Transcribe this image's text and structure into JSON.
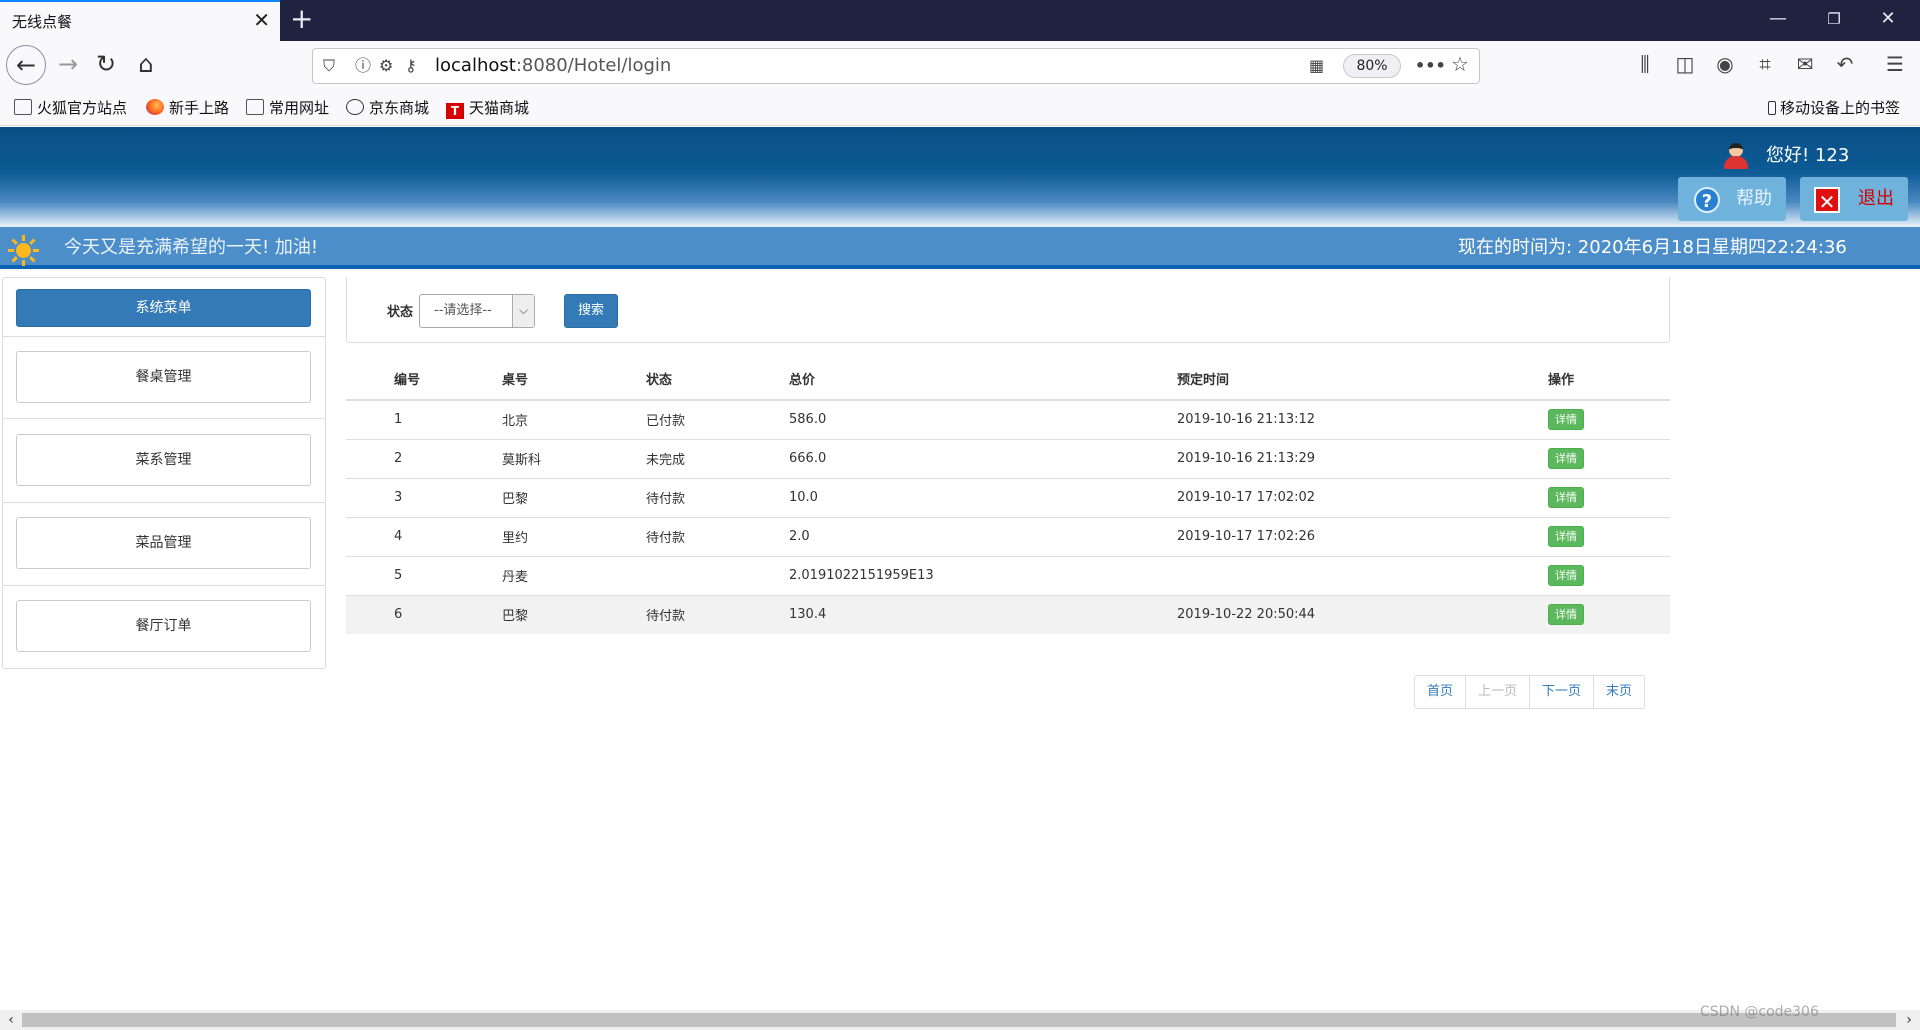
{
  "browser": {
    "tab_title": "无线点餐",
    "url_host": "localhost",
    "url_rest": ":8080/Hotel/login",
    "zoom": "80%",
    "bookmarks": [
      "火狐官方站点",
      "新手上路",
      "常用网址",
      "京东商城",
      "天猫商城"
    ],
    "mobile_bookmarks": "移动设备上的书签"
  },
  "header": {
    "greeting": "您好! 123",
    "help_label": "帮助",
    "exit_label": "退出",
    "motto": "今天又是充满希望的一天! 加油!",
    "clock": "现在的时间为: 2020年6月18日星期四22:24:36"
  },
  "sidebar": {
    "title": "系统菜单",
    "items": [
      "餐桌管理",
      "菜系管理",
      "菜品管理",
      "餐厅订单"
    ]
  },
  "search": {
    "status_label": "状态",
    "select_value": "--请选择--",
    "button_label": "搜索"
  },
  "table": {
    "headers": [
      "编号",
      "桌号",
      "状态",
      "总价",
      "预定时间",
      "操作"
    ],
    "rows": [
      {
        "id": "1",
        "table": "北京",
        "status": "已付款",
        "total": "586.0",
        "time": "2019-10-16 21:13:12",
        "action": "详情"
      },
      {
        "id": "2",
        "table": "莫斯科",
        "status": "未完成",
        "total": "666.0",
        "time": "2019-10-16 21:13:29",
        "action": "详情"
      },
      {
        "id": "3",
        "table": "巴黎",
        "status": "待付款",
        "total": "10.0",
        "time": "2019-10-17 17:02:02",
        "action": "详情"
      },
      {
        "id": "4",
        "table": "里约",
        "status": "待付款",
        "total": "2.0",
        "time": "2019-10-17 17:02:26",
        "action": "详情"
      },
      {
        "id": "5",
        "table": "丹麦",
        "status": "",
        "total": "2.0191022151959E13",
        "time": "",
        "action": "详情"
      },
      {
        "id": "6",
        "table": "巴黎",
        "status": "待付款",
        "total": "130.4",
        "time": "2019-10-22 20:50:44",
        "action": "详情"
      }
    ]
  },
  "pagination": {
    "first": "首页",
    "prev": "上一页",
    "next": "下一页",
    "last": "末页"
  },
  "watermark": "CSDN @code306",
  "colors": {
    "primary": "#337ab7",
    "success": "#5cb85c",
    "header_dark": "#0a4f86",
    "subheader": "#4c8ec9"
  }
}
